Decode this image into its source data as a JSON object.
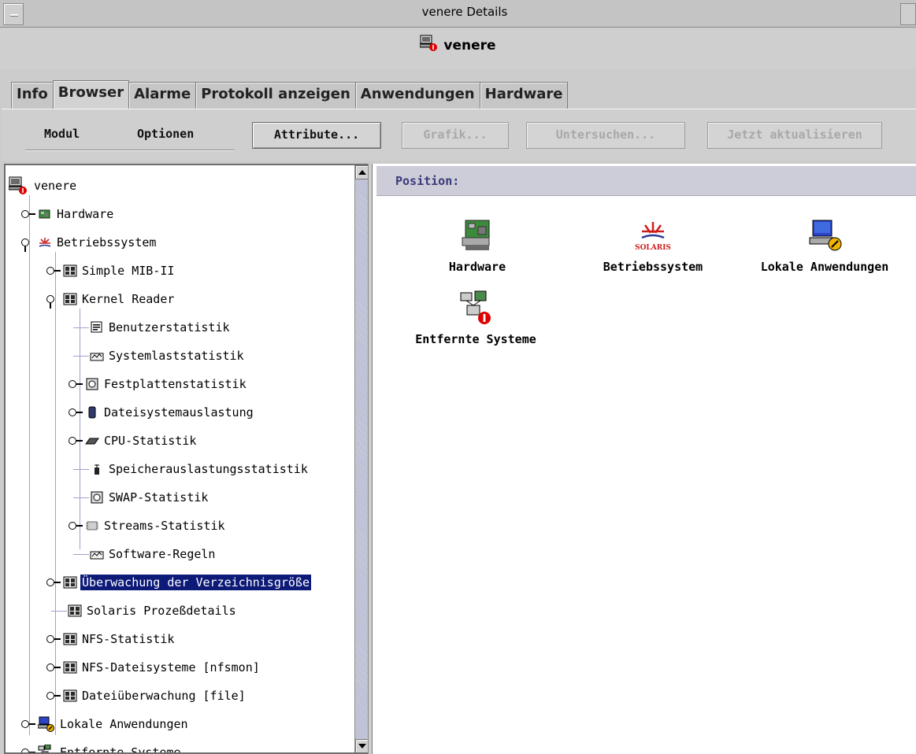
{
  "window": {
    "title": "venere Details"
  },
  "host": {
    "name": "venere"
  },
  "tabs": [
    {
      "label": "Info",
      "active": false
    },
    {
      "label": "Browser",
      "active": true
    },
    {
      "label": "Alarme",
      "active": false
    },
    {
      "label": "Protokoll anzeigen",
      "active": false
    },
    {
      "label": "Anwendungen",
      "active": false
    },
    {
      "label": "Hardware",
      "active": false
    }
  ],
  "toolbar": {
    "menu_modul": "Modul",
    "menu_optionen": "Optionen",
    "attribute": "Attribute...",
    "grafik": "Grafik...",
    "untersuchen": "Untersuchen...",
    "aktualisieren": "Jetzt aktualisieren"
  },
  "tree": {
    "root": "venere",
    "hardware": "Hardware",
    "betriebssystem": "Betriebssystem",
    "simple_mib": "Simple MIB-II",
    "kernel_reader": "Kernel Reader",
    "benutzerstatistik": "Benutzerstatistik",
    "systemlaststatistik": "Systemlaststatistik",
    "festplattenstatistik": "Festplattenstatistik",
    "dateisystemauslastung": "Dateisystemauslastung",
    "cpu_statistik": "CPU-Statistik",
    "speicherauslastung": "Speicherauslastungsstatistik",
    "swap_statistik": "SWAP-Statistik",
    "streams_statistik": "Streams-Statistik",
    "software_regeln": "Software-Regeln",
    "verzeichnisgroesse": "Überwachung der Verzeichnisgröße",
    "prozessdetails": "Solaris Prozeßdetails",
    "nfs_statistik": "NFS-Statistik",
    "nfs_dateisysteme": "NFS-Dateisysteme [nfsmon]",
    "dateiueberwachung": "Dateiüberwachung [file]",
    "lokale_anwendungen": "Lokale Anwendungen",
    "entfernte_systeme": "Entfernte Systeme"
  },
  "content": {
    "position_label": "Position:",
    "items": {
      "hardware": "Hardware",
      "betriebssystem": "Betriebssystem",
      "solaris_logo": "SOLARIS",
      "lokale_anwendungen": "Lokale Anwendungen",
      "entfernte_systeme": "Entfernte Systeme"
    }
  },
  "colors": {
    "selection": "#0d1a78",
    "alarm_red": "#e00000",
    "solaris_red": "#cc1f1f"
  }
}
